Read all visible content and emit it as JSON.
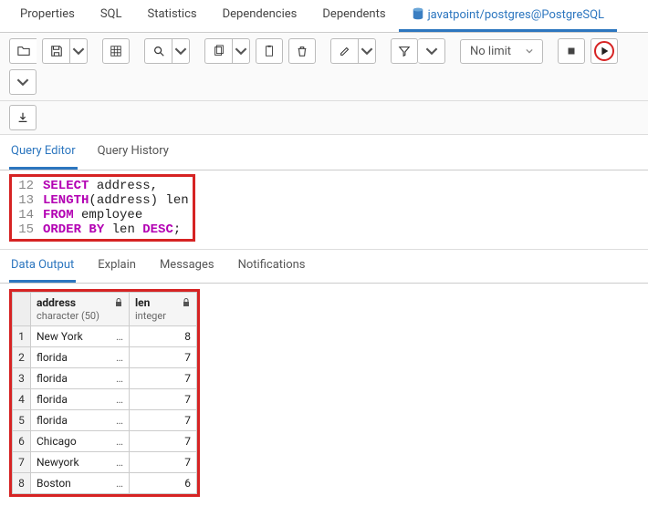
{
  "tabs": {
    "properties": "Properties",
    "sql": "SQL",
    "statistics": "Statistics",
    "dependencies": "Dependencies",
    "dependents": "Dependents",
    "conn": "javatpoint/postgres@PostgreSQL"
  },
  "toolbar": {
    "no_limit": "No limit"
  },
  "editor_tabs": {
    "qe": "Query Editor",
    "qh": "Query History"
  },
  "code": {
    "l12n": "12",
    "l13n": "13",
    "l14n": "14",
    "l15n": "15",
    "select": "SELECT",
    "addr": " address,",
    "length": "LENGTH",
    "lp": "(address) len",
    "from": "FROM",
    "emp": " employee",
    "order": "ORDER",
    "by": "BY",
    "len": " len ",
    "desc": "DESC",
    "semi": ";"
  },
  "result_tabs": {
    "data": "Data Output",
    "explain": "Explain",
    "messages": "Messages",
    "notif": "Notifications"
  },
  "cols": {
    "c1name": "address",
    "c1type": "character (50)",
    "c2name": "len",
    "c2type": "integer"
  },
  "rows": [
    {
      "n": "1",
      "addr": "New York",
      "len": "8"
    },
    {
      "n": "2",
      "addr": "florida",
      "len": "7"
    },
    {
      "n": "3",
      "addr": "florida",
      "len": "7"
    },
    {
      "n": "4",
      "addr": "florida",
      "len": "7"
    },
    {
      "n": "5",
      "addr": "florida",
      "len": "7"
    },
    {
      "n": "6",
      "addr": "Chicago",
      "len": "7"
    },
    {
      "n": "7",
      "addr": "Newyork",
      "len": "7"
    },
    {
      "n": "8",
      "addr": "Boston",
      "len": "6"
    }
  ],
  "chart_data": {
    "type": "table",
    "title": "Data Output",
    "columns": [
      "address (character(50))",
      "len (integer)"
    ],
    "rows": [
      [
        "New York",
        8
      ],
      [
        "florida",
        7
      ],
      [
        "florida",
        7
      ],
      [
        "florida",
        7
      ],
      [
        "florida",
        7
      ],
      [
        "Chicago",
        7
      ],
      [
        "Newyork",
        7
      ],
      [
        "Boston",
        6
      ]
    ]
  }
}
